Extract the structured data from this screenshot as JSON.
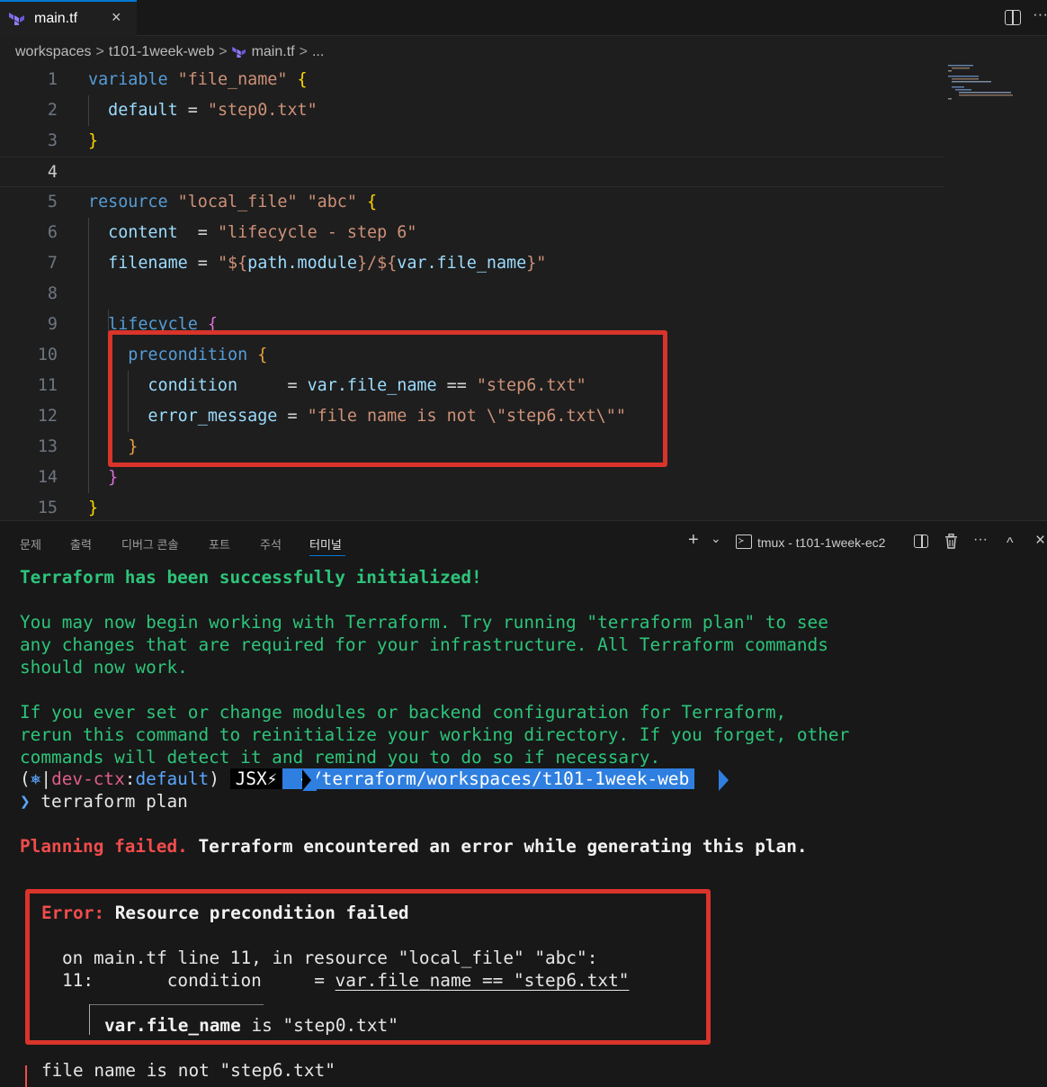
{
  "tab": {
    "title": "main.tf",
    "close": "×"
  },
  "breadcrumb": {
    "items": [
      "workspaces",
      "t101-1week-web",
      "main.tf",
      "..."
    ],
    "separator": ">"
  },
  "code": {
    "line_numbers": [
      "1",
      "2",
      "3",
      "4",
      "5",
      "6",
      "7",
      "8",
      "9",
      "10",
      "11",
      "12",
      "13",
      "14",
      "15"
    ],
    "current_line": 4,
    "lines": [
      [
        [
          "k",
          "variable "
        ],
        [
          "s",
          "\"file_name\""
        ],
        [
          "y",
          " {"
        ]
      ],
      [
        [
          "v",
          "  default"
        ],
        [
          "p",
          " = "
        ],
        [
          "s",
          "\"step0.txt\""
        ]
      ],
      [
        [
          "y",
          "}"
        ]
      ],
      [],
      [
        [
          "k",
          "resource "
        ],
        [
          "s",
          "\"local_file\" \"abc\""
        ],
        [
          "y",
          " {"
        ]
      ],
      [
        [
          "v",
          "  content"
        ],
        [
          "p",
          "  = "
        ],
        [
          "s",
          "\"lifecycle - step 6\""
        ]
      ],
      [
        [
          "v",
          "  filename"
        ],
        [
          "p",
          " = "
        ],
        [
          "s",
          "\"${"
        ],
        [
          "v",
          "path.module"
        ],
        [
          "s",
          "}/${"
        ],
        [
          "v",
          "var.file_name"
        ],
        [
          "s",
          "}\""
        ]
      ],
      [],
      [
        [
          "k",
          "  lifecycle "
        ],
        [
          "o",
          "{"
        ]
      ],
      [
        [
          "k",
          "    precondition "
        ],
        [
          "b",
          "{"
        ]
      ],
      [
        [
          "v",
          "      condition"
        ],
        [
          "p",
          "     = "
        ],
        [
          "v",
          "var.file_name"
        ],
        [
          "p",
          " == "
        ],
        [
          "s",
          "\"step6.txt\""
        ]
      ],
      [
        [
          "v",
          "      error_message"
        ],
        [
          "p",
          " = "
        ],
        [
          "s",
          "\"file name is not \\\"step6.txt\\\"\""
        ]
      ],
      [
        [
          "b",
          "    }"
        ]
      ],
      [
        [
          "o",
          "  }"
        ]
      ],
      [
        [
          "y",
          "}"
        ]
      ]
    ]
  },
  "panel": {
    "tabs": [
      "문제",
      "출력",
      "디버그 콘솔",
      "포트",
      "주석",
      "터미널"
    ],
    "active_tab": "터미널",
    "add_label": "+",
    "dropdown_label": "⌄",
    "terminal_icon": "≻",
    "terminal_name": "tmux - t101-1week-ec2",
    "more_label": "···",
    "maximize_label": "^",
    "close_label": "×"
  },
  "terminal": {
    "init_success": "Terraform has been successfully initialized!",
    "msg1": [
      "You may now begin working with Terraform. Try running \"terraform plan\" to see",
      "any changes that are required for your infrastructure. All Terraform commands",
      "should now work."
    ],
    "msg2": [
      "If you ever set or change modules or backend configuration for Terraform,",
      "rerun this command to reinitialize your working directory. If you forget, other",
      "commands will detect it and remind you to do so if necessary."
    ],
    "prompt": {
      "open": "(",
      "k8s_icon": "⎈",
      "sep": "|",
      "context": "dev-ctx",
      "colon": ":",
      "namespace": "default",
      "close": ")",
      "user": "JSX⚡",
      "path": "~/terraform/workspaces/t101-1week-web"
    },
    "command_arrow": "❯",
    "command": "terraform plan",
    "planning_failed": "Planning failed.",
    "planning_rest": " Terraform encountered an error while generating this plan.",
    "error_label": "Error:",
    "error_title": " Resource precondition failed",
    "error_location": "on main.tf line 11, in resource \"local_file\" \"abc\":",
    "error_line_no": "11:",
    "error_line_pre": "       condition     = ",
    "error_line_expr": "var.file_name == \"step6.txt\"",
    "error_var_name": "var.file_name",
    "error_var_rest": " is \"step0.txt\"",
    "error_message": "file name is not \"step6.txt\""
  },
  "colors": {
    "highlight_box": "#d9342b",
    "accent": "#0078d4",
    "terminal_green": "#2dc47a",
    "terminal_red": "#f14c4c"
  }
}
